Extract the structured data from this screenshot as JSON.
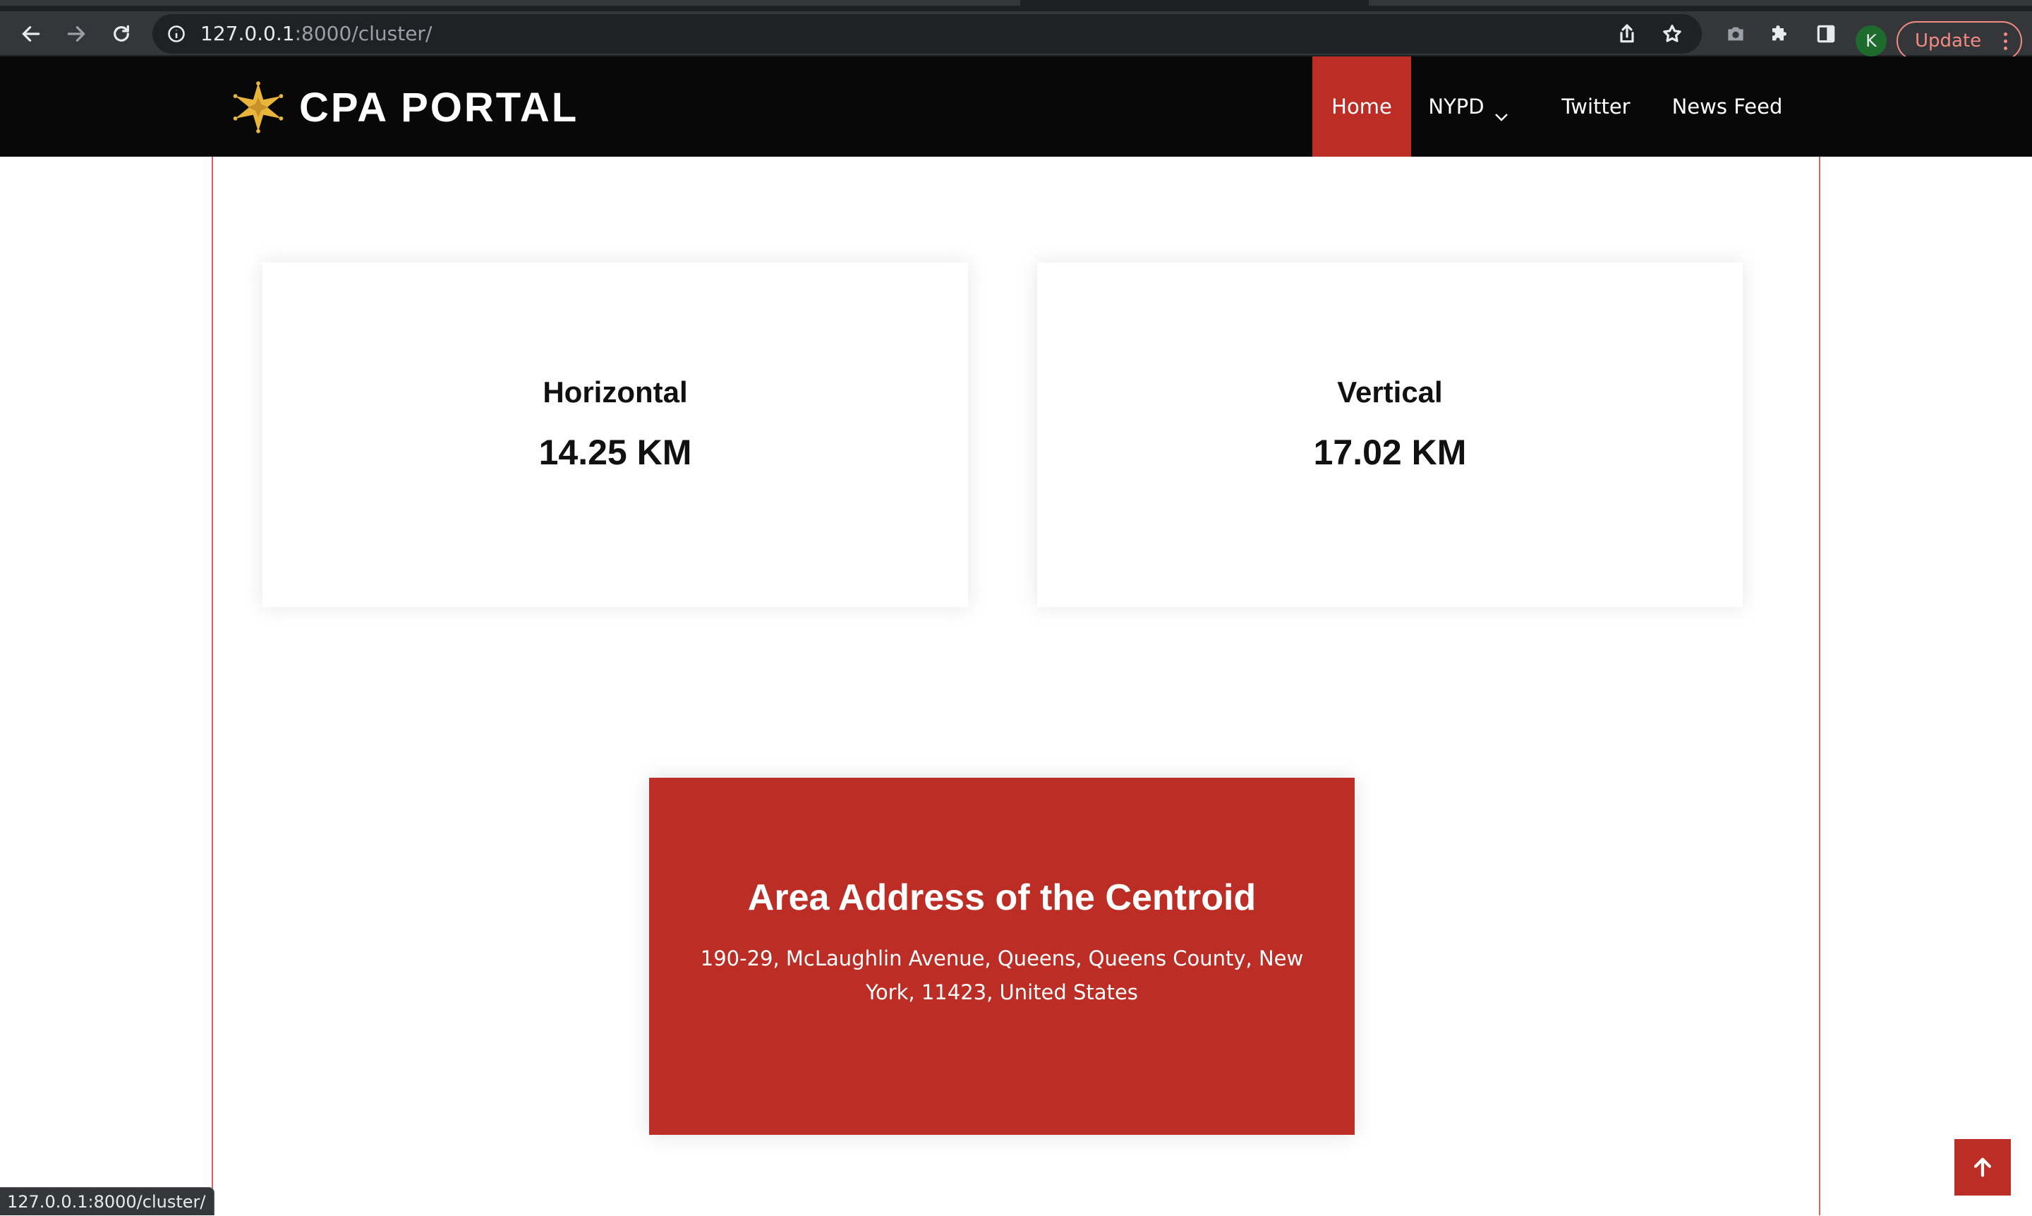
{
  "browser": {
    "url_host": "127.0.0.1",
    "url_path": ":8000/cluster/",
    "profile_initial": "K",
    "update_label": "Update",
    "status_url": "127.0.0.1:8000/cluster/",
    "icons": [
      "back-icon",
      "forward-icon",
      "reload-icon",
      "info-icon",
      "share-icon",
      "bookmark-star-icon",
      "camera-icon",
      "extensions-puzzle-icon",
      "side-panel-icon",
      "kebab-menu-icon"
    ]
  },
  "header": {
    "brand_name": "CPA PORTAL",
    "logo_icon": "sheriff-star-icon",
    "nav": [
      {
        "label": "Home",
        "active": true
      },
      {
        "label": "NYPD",
        "has_dropdown": true
      },
      {
        "label": "Twitter"
      },
      {
        "label": "News Feed"
      }
    ]
  },
  "stats": {
    "horizontal": {
      "label": "Horizontal",
      "value": "14.25 KM"
    },
    "vertical": {
      "label": "Vertical",
      "value": "17.02 KM"
    }
  },
  "address": {
    "title": "Area Address of the Centroid",
    "text": "190-29, McLaughlin Avenue, Queens, Queens County, New York, 11423, United States"
  },
  "colors": {
    "accent": "#bb2d25",
    "header_bg": "#080808",
    "star_gold": "#e8b53a"
  }
}
